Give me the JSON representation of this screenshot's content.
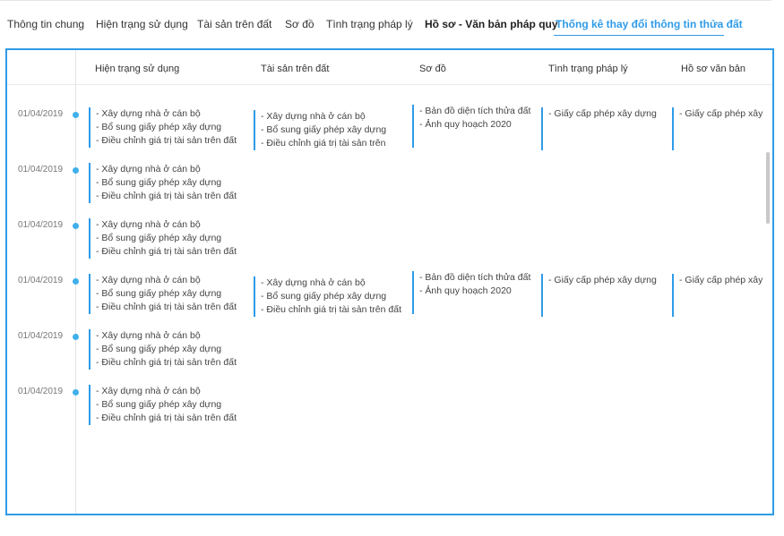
{
  "tabs": [
    {
      "label": "Thông tin chung"
    },
    {
      "label": "Hiện trạng sử dụng"
    },
    {
      "label": "Tài sản trên đất"
    },
    {
      "label": "Sơ đồ"
    },
    {
      "label": "Tình trạng pháp lý"
    },
    {
      "label": "Hồ sơ - Văn bản pháp quy"
    },
    {
      "label": "Thống kê thay đổi thông tin thửa đất"
    }
  ],
  "active_tab": "Thống kê thay đổi thông tin thửa đất",
  "columns": [
    "Hiện trạng sử dụng",
    "Tài sản trên đất",
    "Sơ đồ",
    "Tình trạng pháp lý",
    "Hồ sơ văn bản"
  ],
  "colors": {
    "accent": "#2f9be8",
    "dot": "#3fb0ea"
  },
  "rows": [
    {
      "date": "01/04/2019",
      "hien_trang": [
        "- Xây dựng nhà ở cán bộ",
        "- Bổ sung giấy phép xây dựng",
        "- Điều chỉnh giá trị tài sản trên đất"
      ],
      "tai_san": [
        "- Xây dựng nhà ở cán bộ",
        "- Bổ sung giấy phép xây dựng",
        "- Điều chỉnh giá trị tài sản trên"
      ],
      "so_do": [
        "- Bản đồ diện tích thửa đất",
        "- Ảnh quy hoạch 2020"
      ],
      "phap_ly": [
        "- Giấy cấp phép xây dựng"
      ],
      "ho_so": [
        "- Giấy cấp phép xây"
      ]
    },
    {
      "date": "01/04/2019",
      "hien_trang": [
        "- Xây dựng nhà ở cán bộ",
        "- Bổ sung giấy phép xây dựng",
        "- Điều chỉnh giá trị tài sản trên đất"
      ]
    },
    {
      "date": "01/04/2019",
      "hien_trang": [
        "- Xây dựng nhà ở cán bộ",
        "- Bổ sung giấy phép xây dựng",
        "- Điều chỉnh giá trị tài sản trên đất"
      ]
    },
    {
      "date": "01/04/2019",
      "hien_trang": [
        "- Xây dựng nhà ở cán bộ",
        "- Bổ sung giấy phép xây dựng",
        "- Điều chỉnh giá trị tài sản trên đất"
      ],
      "tai_san": [
        "- Xây dựng nhà ở cán bộ",
        "- Bổ sung giấy phép xây dựng",
        "- Điều chỉnh giá trị tài sản trên đất"
      ],
      "so_do": [
        "- Bản đồ diện tích thửa đất",
        "- Ảnh quy hoạch 2020"
      ],
      "phap_ly": [
        "- Giấy cấp phép xây dựng"
      ],
      "ho_so": [
        "- Giấy cấp phép xây"
      ]
    },
    {
      "date": "01/04/2019",
      "hien_trang": [
        "- Xây dựng nhà ở cán bộ",
        "- Bổ sung giấy phép xây dựng",
        "- Điều chỉnh giá trị tài sản trên đất"
      ]
    },
    {
      "date": "01/04/2019",
      "hien_trang": [
        "- Xây dựng nhà ở cán bộ",
        "- Bổ sung giấy phép xây dựng",
        "- Điều chỉnh giá trị tài sản trên đất"
      ]
    }
  ]
}
